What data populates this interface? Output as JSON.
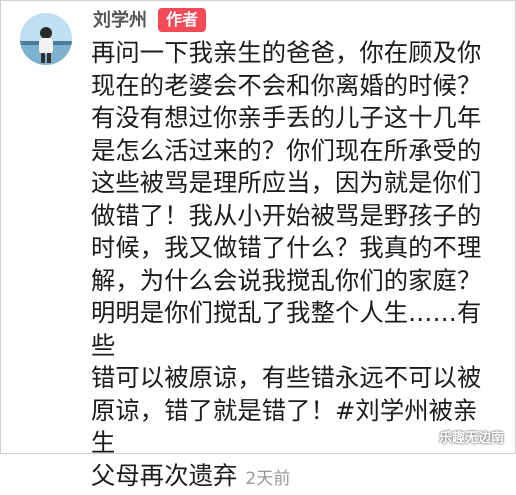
{
  "comment": {
    "author_name": "刘学州",
    "author_badge": "作者",
    "text_lines": [
      "再问一下我亲生的爸爸，你在顾及你",
      "现在的老婆会不会和你离婚的时候？",
      "有没有想过你亲手丢的儿子这十几年",
      "是怎么活过来的？你们现在所承受的",
      "这些被骂是理所应当，因为就是你们",
      "做错了！我从小开始被骂是野孩子的",
      "时候，我又做错了什么？我真的不理",
      "解，为什么会说我搅乱你们的家庭？",
      "明明是你们搅乱了我整个人生……有些",
      "错可以被原谅，有些错永远不可以被",
      "原谅，错了就是错了！#刘学州被亲生",
      "父母再次遗弃"
    ],
    "timestamp": "2天前"
  },
  "watermark": "乐趣无边南",
  "colors": {
    "badge_bg": "#f24a57",
    "name_color": "#555555",
    "time_color": "#999999"
  }
}
